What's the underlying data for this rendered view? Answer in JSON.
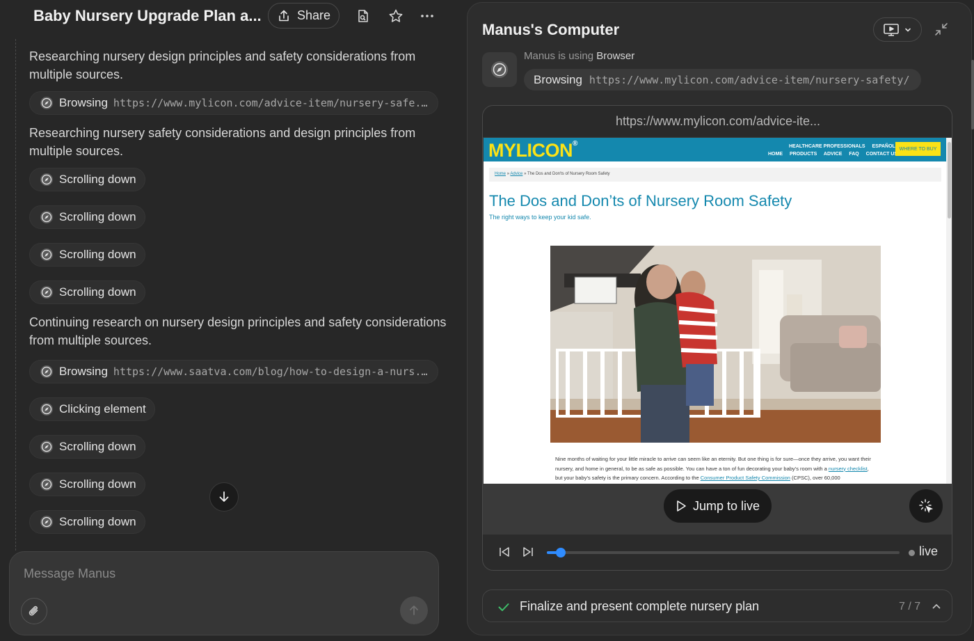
{
  "left": {
    "title": "Baby Nursery Upgrade Plan a...",
    "share_label": "Share",
    "feed": [
      {
        "type": "text",
        "text": "Researching nursery design principles and safety considerations from multiple sources."
      },
      {
        "type": "chip",
        "action": "Browsing",
        "url": "https://www.mylicon.com/advice-item/nursery-safe..."
      },
      {
        "type": "text",
        "text": "Researching nursery safety considerations and design principles from multiple sources."
      },
      {
        "type": "chip",
        "action": "Scrolling down"
      },
      {
        "type": "chip",
        "action": "Scrolling down"
      },
      {
        "type": "chip",
        "action": "Scrolling down"
      },
      {
        "type": "chip",
        "action": "Scrolling down"
      },
      {
        "type": "text",
        "text": "Continuing research on nursery design principles and safety considerations from multiple sources."
      },
      {
        "type": "chip",
        "action": "Browsing",
        "url": "https://www.saatva.com/blog/how-to-design-a-nurs..."
      },
      {
        "type": "chip",
        "action": "Clicking element"
      },
      {
        "type": "chip",
        "action": "Scrolling down"
      },
      {
        "type": "chip",
        "action": "Scrolling down"
      },
      {
        "type": "chip",
        "action": "Scrolling down"
      }
    ],
    "composer": {
      "placeholder": "Message Manus"
    }
  },
  "right": {
    "title": "Manus's Computer",
    "status_prefix": "Manus is using",
    "status_tool": "Browser",
    "current_action": "Browsing",
    "current_url": "https://www.mylicon.com/advice-item/nursery-safety/",
    "address_bar": "https://www.mylicon.com/advice-ite...",
    "page": {
      "logo": "MYLICON",
      "logo_mark": "®",
      "top_links": [
        "HEALTHCARE PROFESSIONALS",
        "ESPAÑOL"
      ],
      "nav_links": [
        "HOME",
        "PRODUCTS",
        "ADVICE",
        "FAQ",
        "CONTACT US"
      ],
      "buy_button": "WHERE TO BUY",
      "breadcrumb_home": "Home",
      "breadcrumb_sep": "»",
      "breadcrumb_advice": "Advice",
      "breadcrumb_current": "The Dos and Don'ts of Nursery Room Safety",
      "headline": "The Dos and Don’ts of Nursery Room Safety",
      "subheadline": "The right ways to keep your kid safe.",
      "body_1": "Nine months of waiting for your little miracle to arrive can seem like an eternity. But one thing is for sure—once they arrive, you want their nursery, and home in general, to be as safe as possible. You can have a ton of fun decorating your baby’s room with a",
      "body_link_1": "nursery checklist",
      "body_2": ", but your baby’s safety is the primary concern. According to the",
      "body_link_2": "Consumer Product Safety Commission",
      "body_3": "(CPSC), over 60,000"
    },
    "jump_to_live": "Jump to live",
    "progress": 0.04,
    "live_label": "live",
    "plan": {
      "text": "Finalize and present complete nursery plan",
      "count": "7 / 7"
    }
  },
  "colors": {
    "accent": "#2f8cff",
    "check": "#3fbf6a",
    "mylicon_blue": "#1488ae",
    "mylicon_yellow": "#fbe216"
  },
  "icons": [
    "share-icon",
    "file-icon",
    "star-icon",
    "more-icon",
    "compass-icon",
    "arrow-down-icon",
    "paperclip-icon",
    "arrow-up-icon",
    "monitor-icon",
    "chevron-down-icon",
    "minimize-icon",
    "play-icon",
    "sparkle-cursor-icon",
    "skip-back-icon",
    "skip-forward-icon",
    "check-icon",
    "chevron-up-icon"
  ]
}
